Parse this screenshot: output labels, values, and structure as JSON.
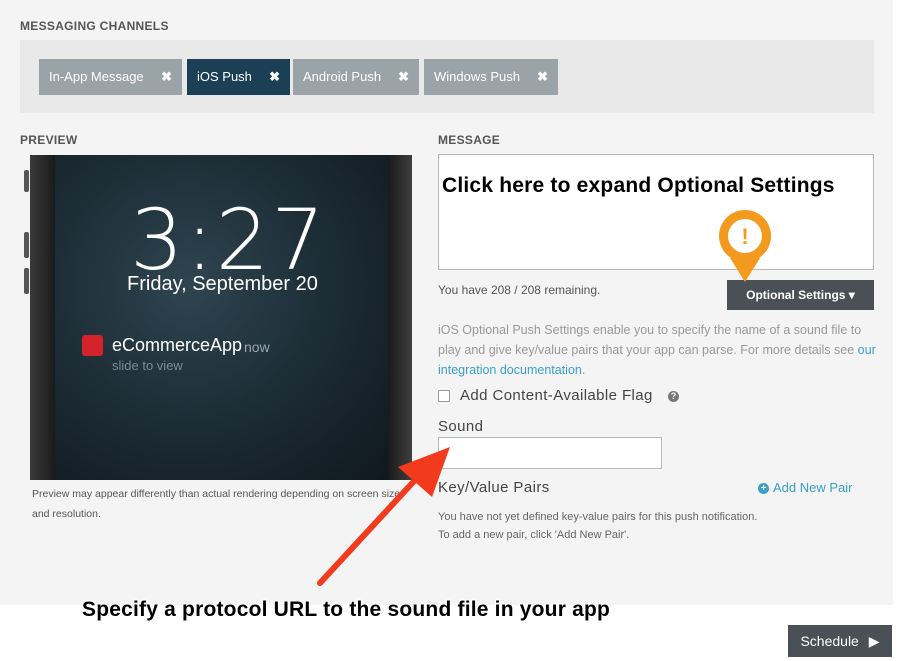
{
  "channels": {
    "title": "MESSAGING CHANNELS",
    "items": [
      {
        "label": "In-App Message",
        "active": false
      },
      {
        "label": "iOS Push",
        "active": true
      },
      {
        "label": "Android Push",
        "active": false
      },
      {
        "label": "Windows Push",
        "active": false
      }
    ],
    "remove_glyph": "✖"
  },
  "preview": {
    "title": "PREVIEW",
    "time": "3:27",
    "date": "Friday, September 20",
    "app_name": "eCommerceApp",
    "app_time": "now",
    "slide_text": "slide to view",
    "note": "Preview may appear differently than actual rendering depending on screen size and resolution."
  },
  "message": {
    "title": "MESSAGE",
    "value": "",
    "remaining": "You have 208 / 208 remaining.",
    "optional_button": "Optional Settings ▾",
    "description_prefix": "iOS Optional Push Settings enable you to specify the name of a sound file to play and give key/value pairs that your app can parse. For more details see ",
    "description_link": "our integration documentation",
    "description_suffix": ".",
    "content_available_label": "Add Content-Available Flag",
    "help_icon": "?",
    "sound_label": "Sound",
    "sound_value": "",
    "kv_label": "Key/Value Pairs",
    "add_pair_label": "Add New Pair",
    "kv_note_line1": "You have not yet defined key-value pairs for this push notification.",
    "kv_note_line2": "To add a new pair, click 'Add New Pair'."
  },
  "annotations": {
    "top_callout": "Click here to expand Optional Settings",
    "bottom_callout": "Specify a protocol URL to the sound file in your app",
    "pin_glyph": "!"
  },
  "footer": {
    "schedule_label": "Schedule"
  },
  "colors": {
    "active_chip": "#1b4055",
    "chip": "#9aa4a8",
    "link": "#3aa0c8",
    "pin_orange": "#f39a1e",
    "arrow_red": "#f23a1c",
    "button_dark": "#4a5055"
  }
}
